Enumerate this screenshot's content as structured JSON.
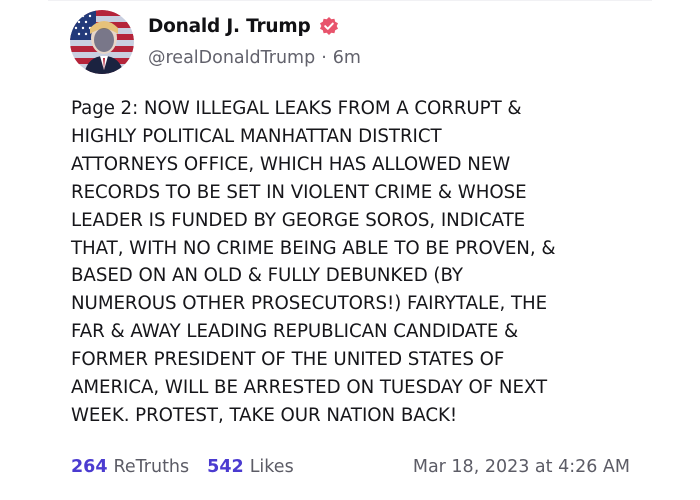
{
  "author": {
    "display_name": "Donald J. Trump",
    "handle": "@realDonaldTrump",
    "separator": "·",
    "time_ago": "6m",
    "avatar_icon": "avatar-image",
    "verified_icon": "verified-badge-icon"
  },
  "post": {
    "text": "Page 2: NOW ILLEGAL LEAKS FROM A CORRUPT &\nHIGHLY POLITICAL MANHATTAN DISTRICT\nATTORNEYS OFFICE, WHICH HAS ALLOWED NEW\nRECORDS TO BE SET IN VIOLENT CRIME & WHOSE\nLEADER IS FUNDED BY GEORGE SOROS, INDICATE\nTHAT, WITH NO CRIME BEING ABLE TO BE PROVEN, &\nBASED ON AN OLD & FULLY DEBUNKED (BY\nNUMEROUS OTHER PROSECUTORS!) FAIRYTALE, THE\nFAR & AWAY LEADING REPUBLICAN CANDIDATE &\nFORMER PRESIDENT OF THE UNITED STATES OF\nAMERICA, WILL BE ARRESTED ON TUESDAY OF NEXT\nWEEK. PROTEST, TAKE OUR NATION BACK!"
  },
  "stats": {
    "retruths_count": "264",
    "retruths_label": "ReTruths",
    "likes_count": "542",
    "likes_label": "Likes",
    "timestamp": "Mar 18, 2023 at 4:26 AM"
  },
  "colors": {
    "accent": "#4b3bd0",
    "verified": "#e8546c",
    "text": "#16161a",
    "muted": "#5c5c66"
  }
}
